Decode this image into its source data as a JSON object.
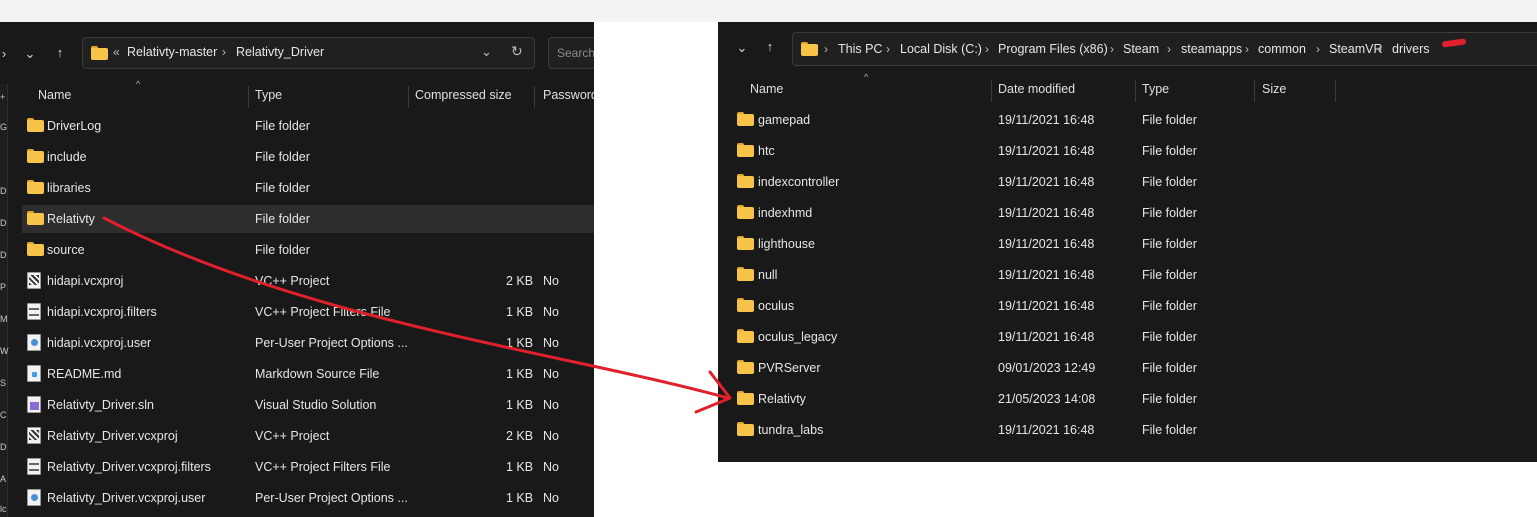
{
  "left": {
    "breadcrumb": [
      "Relativty-master",
      "Relativty_Driver"
    ],
    "breadcrumb_prefix": "«",
    "search_placeholder": "Search",
    "columns": [
      "Name",
      "Type",
      "Compressed size",
      "Password"
    ],
    "rail_letters": [
      "+",
      "G",
      "D",
      "D",
      "D",
      "P",
      "M",
      "W",
      "S",
      "C",
      "D",
      "A",
      "lc"
    ],
    "items": [
      {
        "name": "DriverLog",
        "type": "File folder",
        "size": "",
        "pwd": "",
        "icon": "folder-icon"
      },
      {
        "name": "include",
        "type": "File folder",
        "size": "",
        "pwd": "",
        "icon": "folder-icon"
      },
      {
        "name": "libraries",
        "type": "File folder",
        "size": "",
        "pwd": "",
        "icon": "folder-icon"
      },
      {
        "name": "Relativty",
        "type": "File folder",
        "size": "",
        "pwd": "",
        "icon": "folder-icon"
      },
      {
        "name": "source",
        "type": "File folder",
        "size": "",
        "pwd": "",
        "icon": "folder-icon"
      },
      {
        "name": "hidapi.vcxproj",
        "type": "VC++ Project",
        "size": "2 KB",
        "pwd": "No",
        "icon": "vcxproj-icon"
      },
      {
        "name": "hidapi.vcxproj.filters",
        "type": "VC++ Project Filters File",
        "size": "1 KB",
        "pwd": "No",
        "icon": "filters-icon"
      },
      {
        "name": "hidapi.vcxproj.user",
        "type": "Per-User Project Options ...",
        "size": "1 KB",
        "pwd": "No",
        "icon": "user-file-icon"
      },
      {
        "name": "README.md",
        "type": "Markdown Source File",
        "size": "1 KB",
        "pwd": "No",
        "icon": "markdown-icon"
      },
      {
        "name": "Relativty_Driver.sln",
        "type": "Visual Studio Solution",
        "size": "1 KB",
        "pwd": "No",
        "icon": "sln-icon"
      },
      {
        "name": "Relativty_Driver.vcxproj",
        "type": "VC++ Project",
        "size": "2 KB",
        "pwd": "No",
        "icon": "vcxproj-icon"
      },
      {
        "name": "Relativty_Driver.vcxproj.filters",
        "type": "VC++ Project Filters File",
        "size": "1 KB",
        "pwd": "No",
        "icon": "filters-icon"
      },
      {
        "name": "Relativty_Driver.vcxproj.user",
        "type": "Per-User Project Options ...",
        "size": "1 KB",
        "pwd": "No",
        "icon": "user-file-icon"
      }
    ]
  },
  "right": {
    "breadcrumb": [
      "This PC",
      "Local Disk (C:)",
      "Program Files (x86)",
      "Steam",
      "steamapps",
      "common",
      "SteamVR",
      "drivers"
    ],
    "columns": [
      "Name",
      "Date modified",
      "Type",
      "Size"
    ],
    "items": [
      {
        "name": "gamepad",
        "date": "19/11/2021 16:48",
        "type": "File folder"
      },
      {
        "name": "htc",
        "date": "19/11/2021 16:48",
        "type": "File folder"
      },
      {
        "name": "indexcontroller",
        "date": "19/11/2021 16:48",
        "type": "File folder"
      },
      {
        "name": "indexhmd",
        "date": "19/11/2021 16:48",
        "type": "File folder"
      },
      {
        "name": "lighthouse",
        "date": "19/11/2021 16:48",
        "type": "File folder"
      },
      {
        "name": "null",
        "date": "19/11/2021 16:48",
        "type": "File folder"
      },
      {
        "name": "oculus",
        "date": "19/11/2021 16:48",
        "type": "File folder"
      },
      {
        "name": "oculus_legacy",
        "date": "19/11/2021 16:48",
        "type": "File folder"
      },
      {
        "name": "PVRServer",
        "date": "09/01/2023 12:49",
        "type": "File folder"
      },
      {
        "name": "Relativty",
        "date": "21/05/2023 14:08",
        "type": "File folder"
      },
      {
        "name": "tundra_labs",
        "date": "19/11/2021 16:48",
        "type": "File folder"
      }
    ]
  },
  "colors": {
    "window_bg": "#191919",
    "folder": "#f7c348",
    "arrow": "#e0202a",
    "selected_row": "#2d2d2d"
  }
}
